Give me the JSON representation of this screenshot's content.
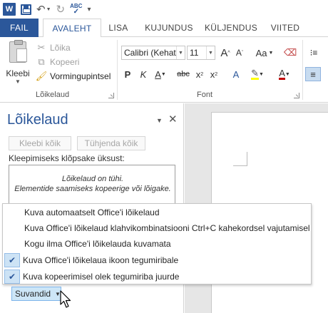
{
  "qat": {
    "word_logo": "W",
    "spell_label": "ABC"
  },
  "tabs": {
    "file": "FAIL",
    "items": [
      "AVALEHT",
      "LISA",
      "KUJUNDUS",
      "KÜLJENDUS",
      "VIITED"
    ],
    "active": "AVALEHT"
  },
  "ribbon": {
    "clipboard": {
      "paste_label": "Kleebi",
      "cut_label": "Lõika",
      "copy_label": "Kopeeri",
      "format_painter_label": "Vormingupintsel",
      "group_label": "Lõikelaud"
    },
    "font": {
      "font_name": "Calibri (Kehate",
      "font_size": "11",
      "group_label": "Font",
      "grow": "A",
      "shrink": "A",
      "case": "Aa",
      "bold": "P",
      "italic": "K",
      "underline": "A",
      "strike": "abc",
      "sub": "x",
      "sup": "x",
      "font_color": "A"
    }
  },
  "pane": {
    "title": "Lõikelaud",
    "paste_all": "Kleebi kõik",
    "clear_all": "Tühjenda kõik",
    "hint": "Kleepimiseks klõpsake üksust:",
    "empty_line1": "Lõikelaud on tühi.",
    "empty_line2": "Elementide saamiseks kopeerige või lõigake."
  },
  "menu": {
    "items": [
      {
        "label": "Kuva automaatselt Office'i lõikelaud",
        "checked": false
      },
      {
        "label": "Kuva Office'i lõikelaud klahvikombinatsiooni Ctrl+C kahekordsel vajutamisel",
        "checked": false
      },
      {
        "label": "Kogu ilma Office'i lõikelauda kuvamata",
        "checked": false
      },
      {
        "label": "Kuva Office'i lõikelaua ikoon tegumiribale",
        "checked": true
      },
      {
        "label": "Kuva kopeerimisel olek tegumiriba juurde",
        "checked": true
      }
    ]
  },
  "options_button": "Suvandid",
  "colors": {
    "accent": "#2b579a",
    "menu_check_bg": "#cde3f5",
    "options_bg": "#cde6f7",
    "highlight_yellow": "#ffff00",
    "font_red": "#c00000"
  }
}
